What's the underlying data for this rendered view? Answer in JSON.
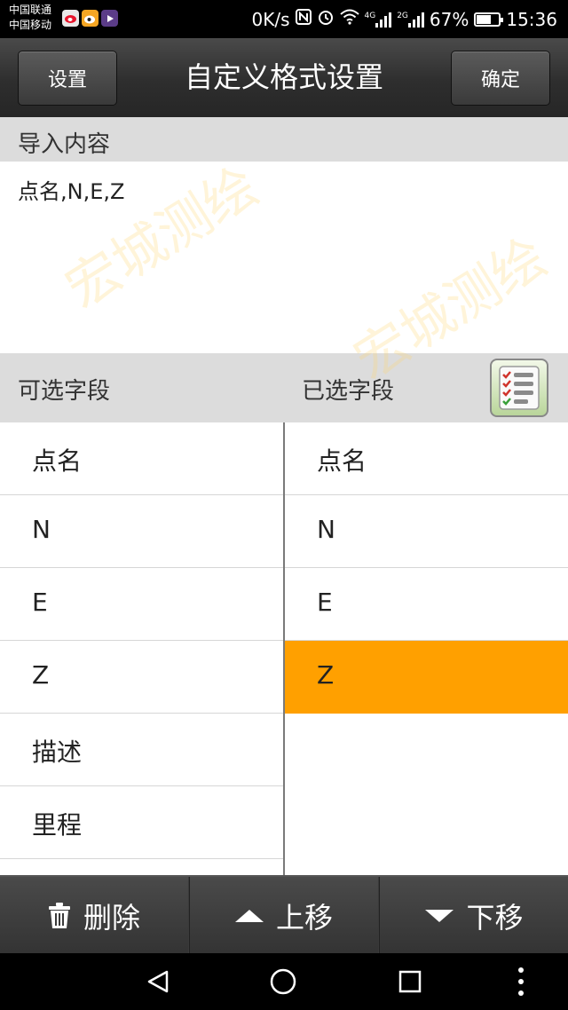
{
  "status_bar": {
    "carrier_1": "中国联通",
    "carrier_2": "中国移动",
    "net_speed": "0K/s",
    "signal_1_tag": "4G",
    "signal_2_tag": "2G",
    "battery": "67%",
    "battery_level": 0.67,
    "time": "15:36",
    "app_icons": [
      "weibo-sina-icon",
      "weibo-icon",
      "video-icon"
    ]
  },
  "header": {
    "left_button": "设置",
    "title": "自定义格式设置",
    "right_button": "确定"
  },
  "import": {
    "label": "导入内容",
    "content": "点名,N,E,Z"
  },
  "fields": {
    "available_label": "可选字段",
    "selected_label": "已选字段",
    "available": [
      "点名",
      "N",
      "E",
      "Z",
      "描述",
      "里程"
    ],
    "selected": [
      "点名",
      "N",
      "E",
      "Z"
    ],
    "highlighted_selected_index": 3
  },
  "toolbar": {
    "delete": "删除",
    "move_up": "上移",
    "move_down": "下移"
  },
  "watermark": "宏城测绘",
  "colors": {
    "highlight": "#ffa000",
    "titlebar": "#2e2e2e",
    "section_bg": "#dcdcdc"
  }
}
